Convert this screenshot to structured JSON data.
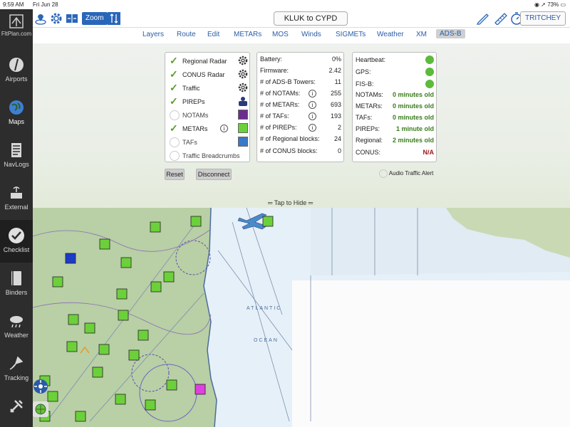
{
  "status_bar": {
    "time": "9:59 AM",
    "date": "Fri Jun 28",
    "battery": "73%"
  },
  "logo": {
    "text": "FltPlan.com"
  },
  "sidebar": {
    "items": [
      {
        "label": "Airports",
        "icon": "airport-icon"
      },
      {
        "label": "Maps",
        "icon": "globe-icon"
      },
      {
        "label": "NavLogs",
        "icon": "navlog-icon"
      },
      {
        "label": "External",
        "icon": "external-device-icon"
      },
      {
        "label": "Checklist",
        "icon": "checkmark-icon"
      },
      {
        "label": "Binders",
        "icon": "binder-icon"
      },
      {
        "label": "Weather",
        "icon": "weather-icon"
      },
      {
        "label": "Tracking",
        "icon": "tracking-icon"
      },
      {
        "label": "",
        "icon": "tools-icon"
      }
    ]
  },
  "toolbar": {
    "zoom_label": "Zoom",
    "route_label": "KLUK to CYPD",
    "user_label": "TRITCHEY"
  },
  "tabs": [
    "Layers",
    "Route",
    "Edit",
    "METARs",
    "MOS",
    "Winds",
    "SIGMETs",
    "Weather",
    "XM",
    "ADS-B"
  ],
  "active_tab": "ADS-B",
  "layers": [
    {
      "label": "Regional Radar",
      "checked": true,
      "control": "gear"
    },
    {
      "label": "CONUS Radar",
      "checked": true,
      "control": "gear"
    },
    {
      "label": "Traffic",
      "checked": true,
      "control": "gear"
    },
    {
      "label": "PIREPs",
      "checked": true,
      "control": "pirep"
    },
    {
      "label": "NOTAMs",
      "checked": false,
      "control": "swatch",
      "color": "#6b2e8f"
    },
    {
      "label": "METARs",
      "checked": true,
      "control": "swatch",
      "color": "#6cd03a",
      "info": true
    },
    {
      "label": "TAFs",
      "checked": false,
      "control": "swatch",
      "color": "#3a78c8"
    },
    {
      "label": "Traffic Breadcrumbs",
      "checked": false,
      "control": "none"
    }
  ],
  "stats": [
    {
      "label": "Battery:",
      "value": "0%"
    },
    {
      "label": "Firmware:",
      "value": "2.42"
    },
    {
      "label": "# of ADS-B Towers:",
      "value": "11"
    },
    {
      "label": "# of NOTAMs:",
      "value": "255",
      "info": true
    },
    {
      "label": "# of METARs:",
      "value": "693",
      "info": true
    },
    {
      "label": "# of TAFs:",
      "value": "193",
      "info": true
    },
    {
      "label": "# of PIREPs:",
      "value": "2",
      "info": true
    },
    {
      "label": "# of Regional blocks:",
      "value": "24"
    },
    {
      "label": "# of CONUS blocks:",
      "value": "0"
    }
  ],
  "status": [
    {
      "label": "Heartbeat:",
      "indicator": "green"
    },
    {
      "label": "GPS:",
      "indicator": "green"
    },
    {
      "label": "FIS-B:",
      "indicator": "green"
    },
    {
      "label": "NOTAMs:",
      "value": "0 minutes old"
    },
    {
      "label": "METARs:",
      "value": "0 minutes old"
    },
    {
      "label": "TAFs:",
      "value": "0 minutes old"
    },
    {
      "label": "PIREPs:",
      "value": "1 minute old"
    },
    {
      "label": "Regional:",
      "value": "2 minutes old"
    },
    {
      "label": "CONUS:",
      "value": "N/A",
      "bad": true
    }
  ],
  "buttons": {
    "reset": "Reset",
    "disconnect": "Disconnect"
  },
  "audio_alert": {
    "label": "Audio Traffic Alert",
    "checked": false
  },
  "hide_label": "Tap to Hide",
  "map": {
    "ocean_labels": [
      "ATLANTIC",
      "OCEAN"
    ],
    "colors": {
      "metar": "#6cd03a",
      "metar_ifr": "#1a3cc8",
      "metar_lifr": "#e040e0",
      "water": "#e6f0f8",
      "land": "#b9cfa5"
    }
  }
}
